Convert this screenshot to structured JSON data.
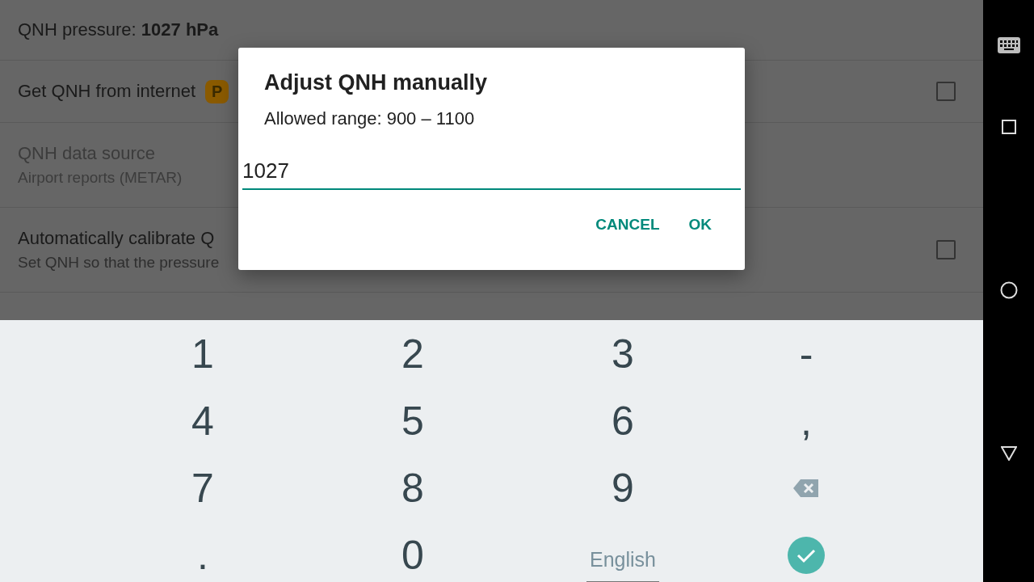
{
  "settings": [
    {
      "kind": "value",
      "label": "QNH pressure: **1027 hPa**",
      "disabled": false
    },
    {
      "kind": "checkbox",
      "title": "Get QNH from internet",
      "badge": "P",
      "checked": false,
      "disabled": false
    },
    {
      "kind": "text",
      "title": "QNH data source",
      "subtitle": "Airport reports (METAR)",
      "disabled": true
    },
    {
      "kind": "checkbox",
      "title": "Automatically calibrate Q",
      "subtitle": "Set QNH so that the pressure",
      "checked": false,
      "disabled": false
    }
  ],
  "dialog": {
    "title": "Adjust QNH manually",
    "message": "Allowed range: 900 – 1100",
    "value": "1027",
    "buttons": [
      "CANCEL",
      "OK"
    ]
  },
  "keyboard": {
    "keys": [
      {
        "kind": "char",
        "label": "1"
      },
      {
        "kind": "char",
        "label": "2"
      },
      {
        "kind": "char",
        "label": "3"
      },
      {
        "kind": "char",
        "label": "-"
      },
      {
        "kind": "char",
        "label": "4"
      },
      {
        "kind": "char",
        "label": "5"
      },
      {
        "kind": "char",
        "label": "6"
      },
      {
        "kind": "char",
        "label": ","
      },
      {
        "kind": "char",
        "label": "7"
      },
      {
        "kind": "char",
        "label": "8"
      },
      {
        "kind": "char",
        "label": "9"
      },
      {
        "kind": "backspace"
      },
      {
        "kind": "char",
        "label": "."
      },
      {
        "kind": "char",
        "label": "0"
      },
      {
        "kind": "language",
        "label": "English"
      },
      {
        "kind": "enter"
      }
    ]
  }
}
